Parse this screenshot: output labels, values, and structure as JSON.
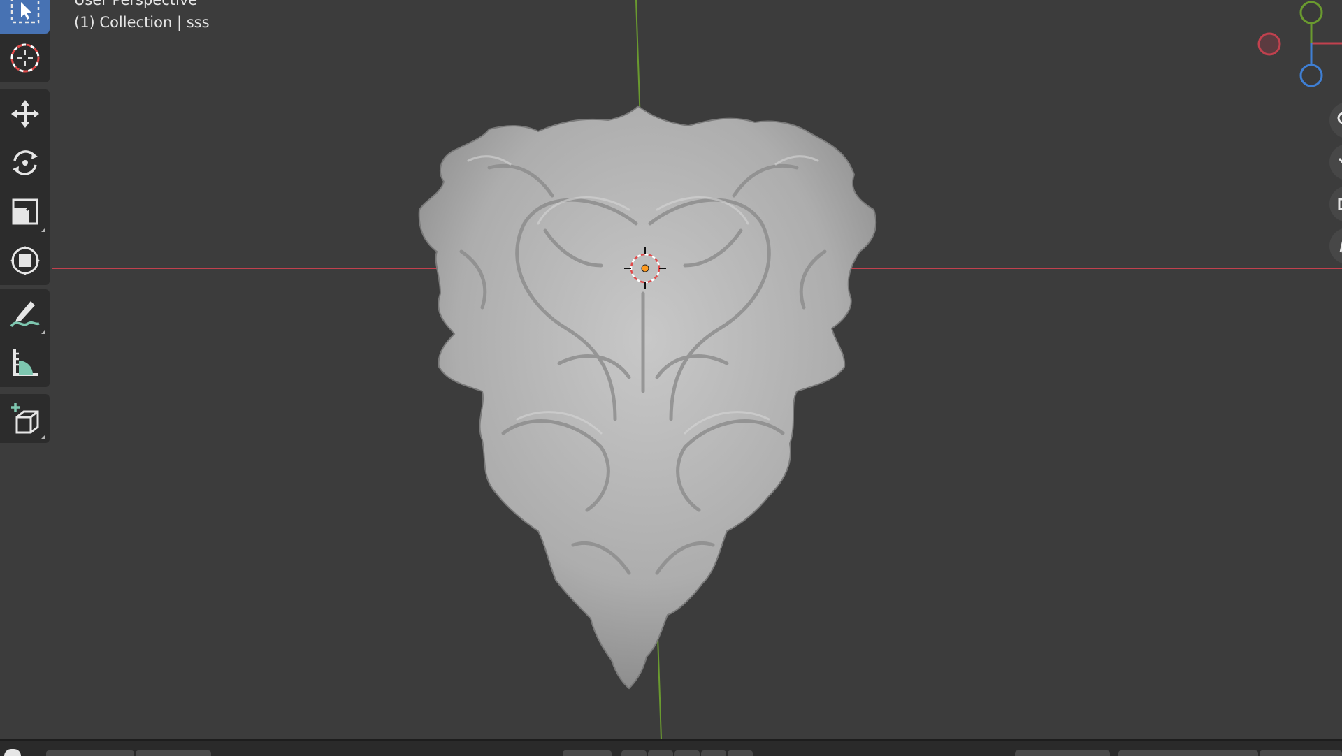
{
  "viewport": {
    "view_name": "User Perspective",
    "collection_label": "(1) Collection | sss",
    "colors": {
      "background": "#3c3c3c",
      "x_axis": "#c1414e",
      "y_axis": "#6a9a2f",
      "z_axis": "#3f7fd4",
      "model": "#bdbdbd"
    }
  },
  "toolbar": {
    "tools": [
      {
        "name": "select-box",
        "icon": "select-box-icon",
        "active": true
      },
      {
        "name": "cursor",
        "icon": "cursor-3d-icon",
        "active": false
      },
      {
        "name": "move",
        "icon": "move-icon",
        "active": false
      },
      {
        "name": "rotate",
        "icon": "rotate-icon",
        "active": false
      },
      {
        "name": "scale",
        "icon": "scale-icon",
        "active": false
      },
      {
        "name": "transform",
        "icon": "transform-icon",
        "active": false
      },
      {
        "name": "annotate",
        "icon": "annotate-icon",
        "active": false
      },
      {
        "name": "measure",
        "icon": "measure-icon",
        "active": false
      },
      {
        "name": "add-cube",
        "icon": "add-cube-icon",
        "active": false
      }
    ]
  },
  "gizmo": {
    "axes": [
      "x-axis-negative",
      "y-axis",
      "z-axis",
      "x-axis-positive"
    ],
    "nav_buttons": [
      "zoom-icon",
      "pan-icon",
      "camera-icon",
      "perspective-icon"
    ]
  }
}
